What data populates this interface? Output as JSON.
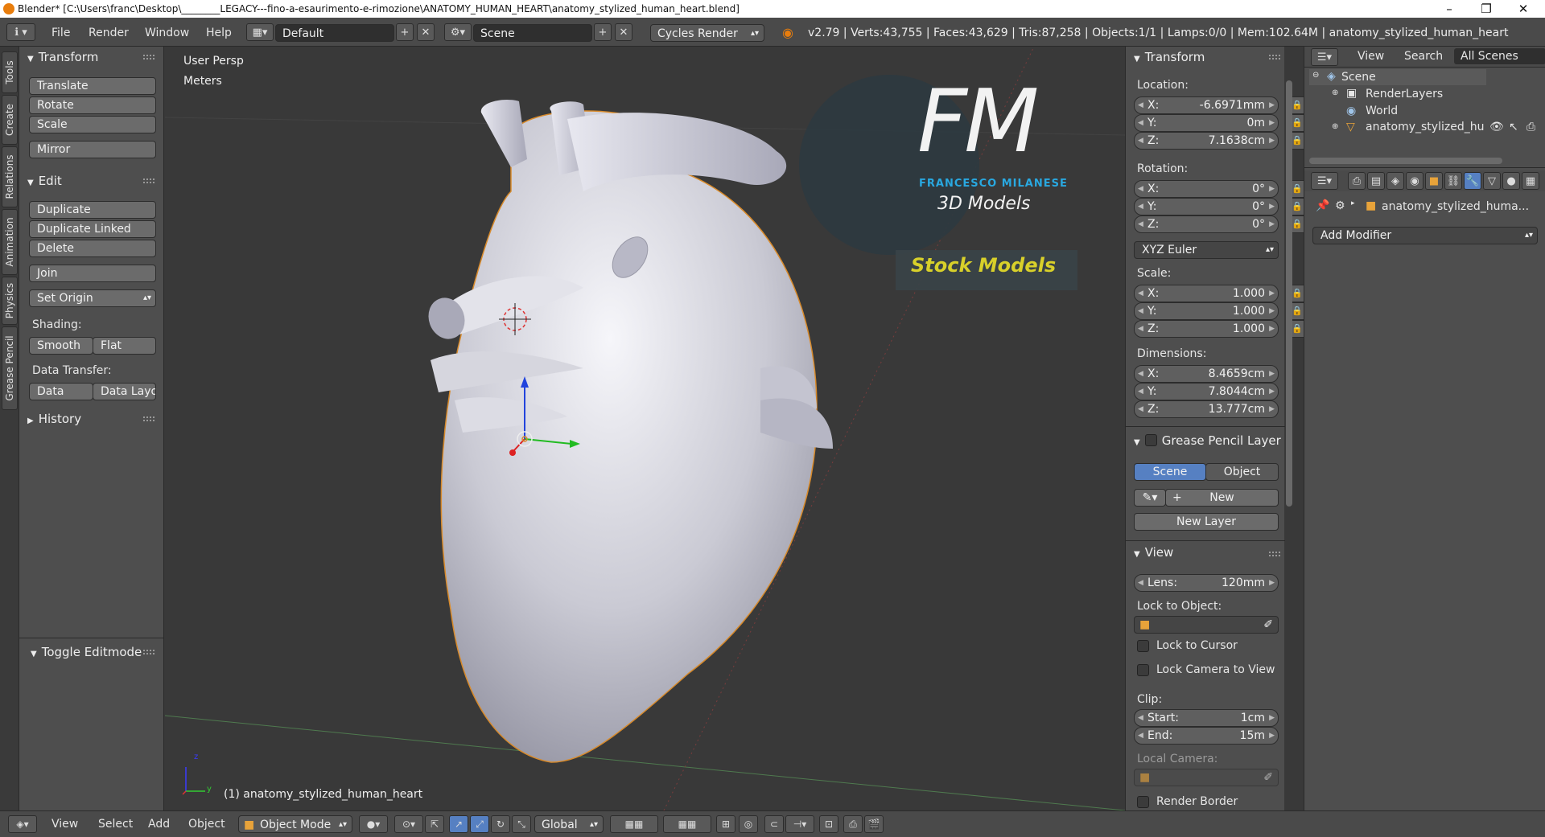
{
  "titlebar": {
    "title": "Blender* [C:\\Users\\franc\\Desktop\\________LEGACY---fino-a-esaurimento-e-rimozione\\ANATOMY_HUMAN_HEART\\anatomy_stylized_human_heart.blend]",
    "minimize": "–",
    "maximize": "❐",
    "close": "✕"
  },
  "infobar": {
    "menus": [
      "File",
      "Render",
      "Window",
      "Help"
    ],
    "screen_layout": "Default",
    "scene": "Scene",
    "engine": "Cycles Render",
    "stats": "v2.79 | Verts:43,755 | Faces:43,629 | Tris:87,258 | Objects:1/1 | Lamps:0/0 | Mem:102.64M | anatomy_stylized_human_heart"
  },
  "vtabs": [
    "Tools",
    "Create",
    "Relations",
    "Animation",
    "Physics",
    "Grease Pencil"
  ],
  "tools": {
    "transform_header": "Transform",
    "translate": "Translate",
    "rotate": "Rotate",
    "scale": "Scale",
    "mirror": "Mirror",
    "edit_header": "Edit",
    "duplicate": "Duplicate",
    "duplicate_linked": "Duplicate Linked",
    "delete": "Delete",
    "join": "Join",
    "set_origin": "Set Origin",
    "shading_label": "Shading:",
    "smooth": "Smooth",
    "flat": "Flat",
    "data_transfer_label": "Data Transfer:",
    "data": "Data",
    "data_layout": "Data Layo",
    "history_header": "History",
    "toggle_editmode": "Toggle Editmode"
  },
  "viewport": {
    "view_name": "User Persp",
    "units": "Meters",
    "object_label": "(1) anatomy_stylized_human_heart",
    "logo": {
      "letters": "FM",
      "name": "FRANCESCO MILANESE",
      "sub": "3D Models",
      "banner": "Stock Models"
    }
  },
  "npanel": {
    "transform_header": "Transform",
    "location_label": "Location:",
    "location": [
      {
        "k": "X:",
        "v": "-6.6971mm"
      },
      {
        "k": "Y:",
        "v": "0m"
      },
      {
        "k": "Z:",
        "v": "7.1638cm"
      }
    ],
    "rotation_label": "Rotation:",
    "rotation": [
      {
        "k": "X:",
        "v": "0°"
      },
      {
        "k": "Y:",
        "v": "0°"
      },
      {
        "k": "Z:",
        "v": "0°"
      }
    ],
    "rotation_mode": "XYZ Euler",
    "scale_label": "Scale:",
    "scale": [
      {
        "k": "X:",
        "v": "1.000"
      },
      {
        "k": "Y:",
        "v": "1.000"
      },
      {
        "k": "Z:",
        "v": "1.000"
      }
    ],
    "dimensions_label": "Dimensions:",
    "dimensions": [
      {
        "k": "X:",
        "v": "8.4659cm"
      },
      {
        "k": "Y:",
        "v": "7.8044cm"
      },
      {
        "k": "Z:",
        "v": "13.777cm"
      }
    ],
    "grease_header": "Grease Pencil Layer",
    "scene_tab": "Scene",
    "object_tab": "Object",
    "new": "New",
    "new_layer": "New Layer",
    "view_header": "View",
    "lens_k": "Lens:",
    "lens_v": "120mm",
    "lock_to_object": "Lock to Object:",
    "lock_to_cursor": "Lock to Cursor",
    "lock_camera": "Lock Camera to View",
    "clip_label": "Clip:",
    "clip_start_k": "Start:",
    "clip_start_v": "1cm",
    "clip_end_k": "End:",
    "clip_end_v": "15m",
    "local_camera": "Local Camera:",
    "render_border": "Render Border"
  },
  "outliner": {
    "view": "View",
    "search": "Search",
    "filter": "All Scenes",
    "items": [
      "Scene",
      "RenderLayers",
      "World",
      "anatomy_stylized_hum"
    ]
  },
  "properties": {
    "object_name": "anatomy_stylized_huma...",
    "add_modifier": "Add Modifier"
  },
  "bottombar": {
    "view": "View",
    "select": "Select",
    "add": "Add",
    "object": "Object",
    "mode": "Object Mode",
    "orientation": "Global"
  },
  "colors": {
    "accent_blue": "#5680c2",
    "logo_cyan": "#29a8e0",
    "banner_yellow": "#d8d02a",
    "heart": "#c9c9d2"
  }
}
